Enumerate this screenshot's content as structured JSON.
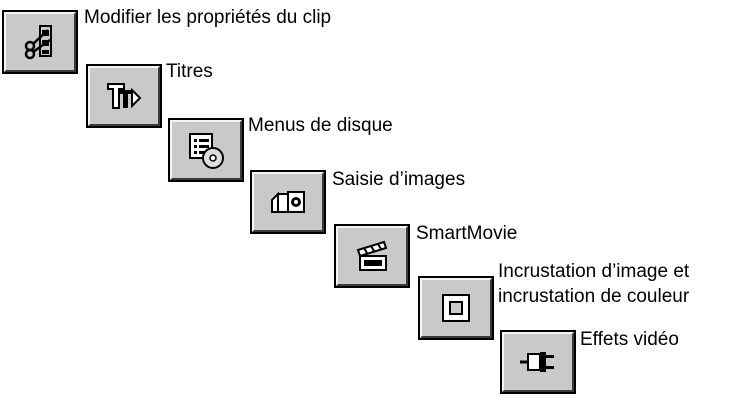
{
  "tools": [
    {
      "label": "Modifier les propriétés du clip",
      "icon": "scissors-clip-icon"
    },
    {
      "label": "Titres",
      "icon": "title-text-icon"
    },
    {
      "label": "Menus de disque",
      "icon": "disc-menu-icon"
    },
    {
      "label": "Saisie d’images",
      "icon": "camera-capture-icon"
    },
    {
      "label": "SmartMovie",
      "icon": "clapperboard-icon"
    },
    {
      "label_line1": "Incrustation d’image et",
      "label_line2": "incrustation de couleur",
      "icon": "picture-in-picture-icon"
    },
    {
      "label": "Effets vidéo",
      "icon": "plug-effects-icon"
    }
  ]
}
